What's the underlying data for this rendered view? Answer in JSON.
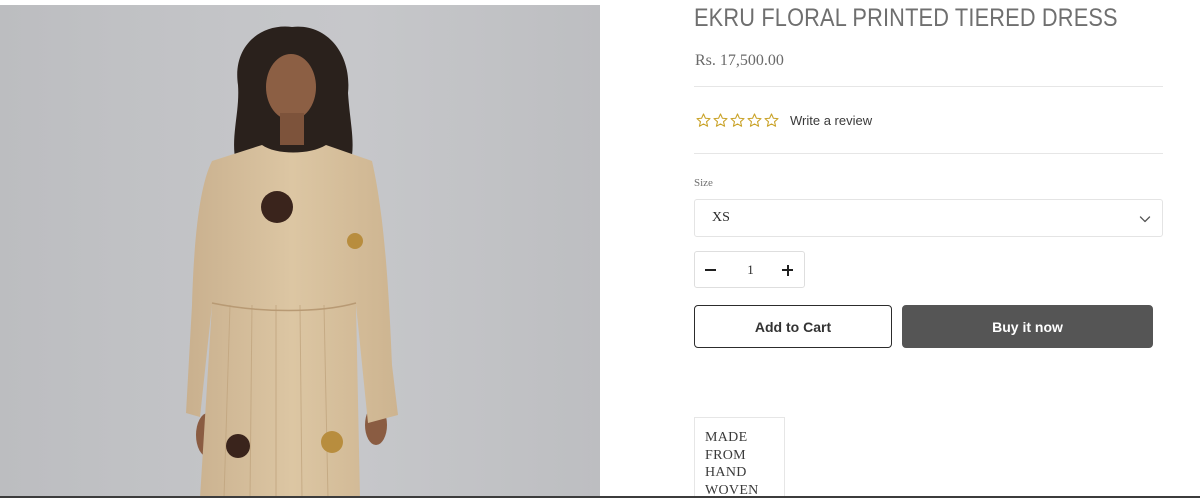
{
  "product": {
    "title": "EKRU FLORAL PRINTED TIERED DRESS",
    "price": "Rs. 17,500.00",
    "rating": {
      "stars_filled": 0,
      "stars_total": 5
    },
    "write_review_label": "Write a review",
    "size_label": "Size",
    "size_selected": "XS",
    "quantity": "1",
    "add_to_cart_label": "Add to Cart",
    "buy_now_label": "Buy it now",
    "badge_lines": [
      "MADE",
      "FROM",
      "HAND",
      "WOVEN"
    ]
  },
  "icons": {
    "star": "star-outline-icon",
    "chevron": "chevron-down-icon",
    "minus": "minus-icon",
    "plus": "plus-icon"
  },
  "colors": {
    "star_outline": "#c9a227",
    "buy_button_bg": "#555555",
    "title_text": "#6f6f6f"
  }
}
